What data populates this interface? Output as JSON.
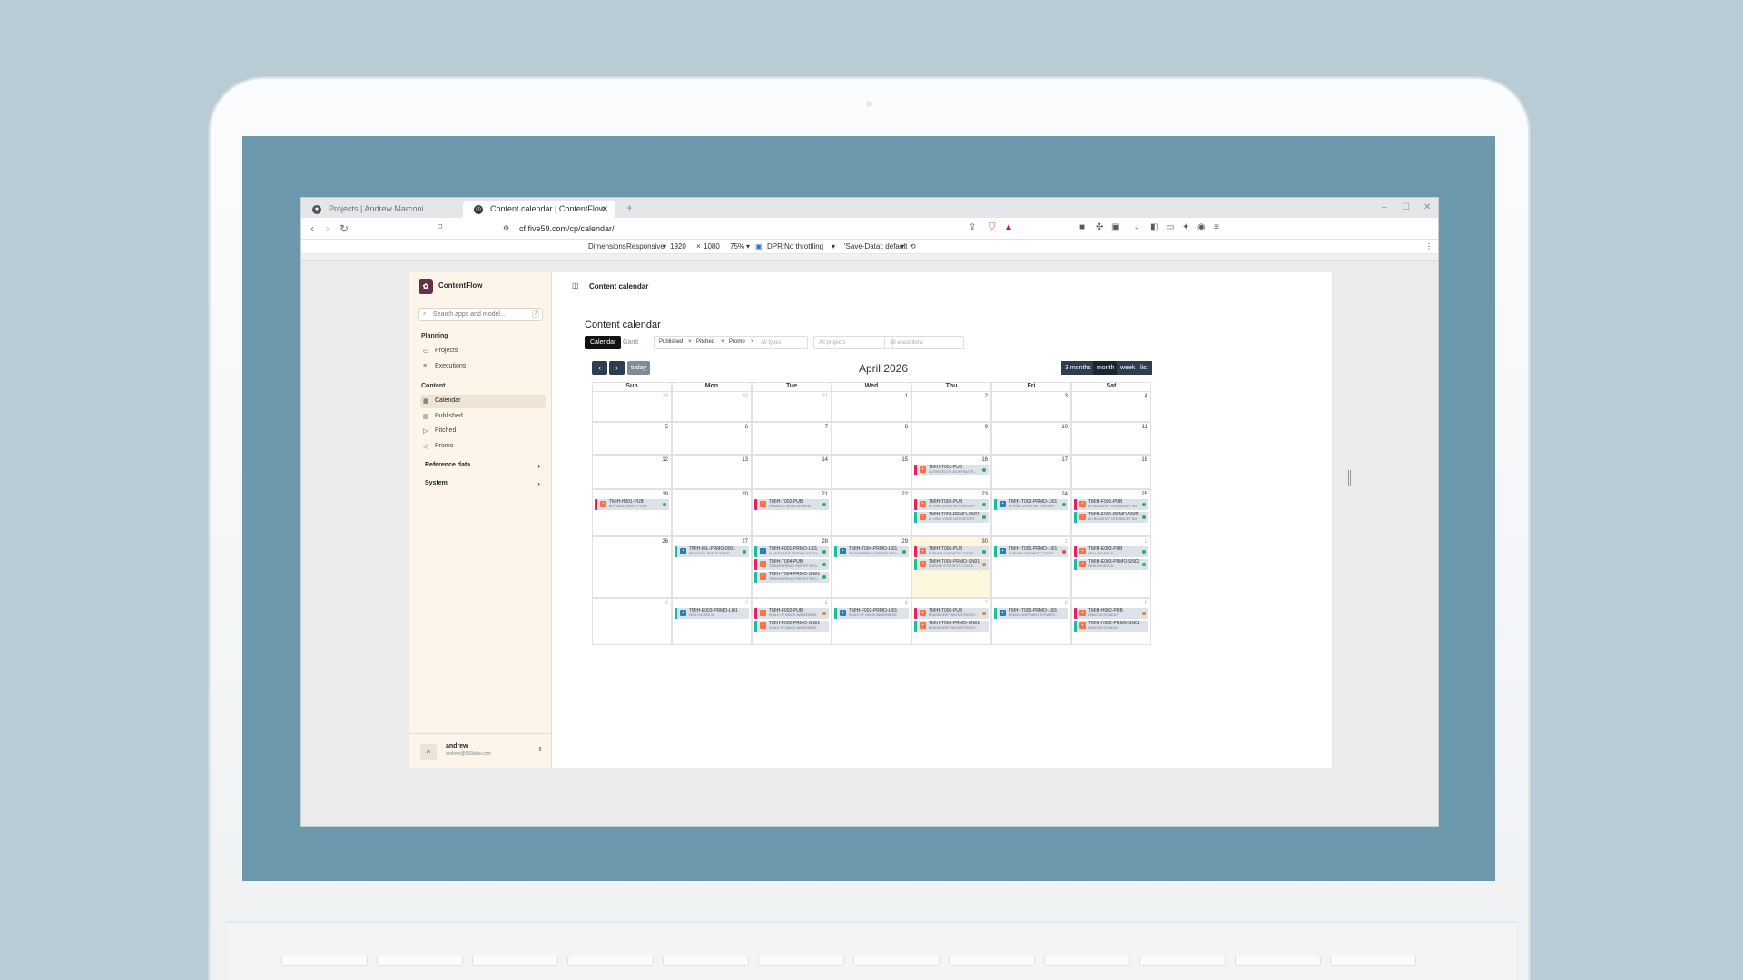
{
  "browser": {
    "tabs": [
      {
        "title": "Projects | Andrew Marconi",
        "active": false
      },
      {
        "title": "Content calendar | ContentFlow",
        "active": true
      }
    ],
    "url": "cf.five59.com/cp/calendar/",
    "devtools": {
      "dimensions_label": "Dimensions:",
      "device": "Responsive",
      "width": "1920",
      "height": "1080",
      "zoom": "75%",
      "dpr": "DPR:",
      "throttling": "No throttling",
      "save_data": "'Save-Data': default"
    }
  },
  "app": {
    "brand": "ContentFlow",
    "search_placeholder": "Search apps and model...",
    "search_shortcut": "/",
    "sections": {
      "planning": "Planning",
      "content": "Content"
    },
    "planning_items": [
      "Projects",
      "Executions"
    ],
    "content_items": [
      "Calendar",
      "Published",
      "Pitched",
      "Promo"
    ],
    "groups": [
      "Reference data",
      "System"
    ],
    "user": {
      "initial": "A",
      "name": "andrew",
      "email": "andrew@559labs.com"
    },
    "topbar_title": "Content calendar"
  },
  "page": {
    "title": "Content calendar",
    "views": [
      "Calendar",
      "Gantt"
    ],
    "type_chips": [
      "Published",
      "Pitched",
      "Promo"
    ],
    "types_placeholder": "All types",
    "projects_placeholder": "All projects",
    "executions_placeholder": "All executions",
    "today": "today",
    "month_title": "April 2026",
    "view_buttons": [
      "3 months",
      "month",
      "week",
      "list"
    ]
  },
  "calendar": {
    "weekdays": [
      "Sun",
      "Mon",
      "Tue",
      "Wed",
      "Thu",
      "Fri",
      "Sat"
    ],
    "weeks": [
      [
        {
          "d": "29",
          "dim": true
        },
        {
          "d": "30",
          "dim": true
        },
        {
          "d": "31",
          "dim": true
        },
        {
          "d": "1"
        },
        {
          "d": "2"
        },
        {
          "d": "3"
        },
        {
          "d": "4"
        }
      ],
      [
        {
          "d": "5"
        },
        {
          "d": "6"
        },
        {
          "d": "7"
        },
        {
          "d": "8"
        },
        {
          "d": "9"
        },
        {
          "d": "10"
        },
        {
          "d": "11"
        }
      ],
      [
        {
          "d": "12"
        },
        {
          "d": "13"
        },
        {
          "d": "14"
        },
        {
          "d": "15"
        },
        {
          "d": "16",
          "events": [
            {
              "t": "TMIH-T001-PUB",
              "s": "AUTHENTICITY AS INFRASTR...",
              "bar": "#e91e63",
              "icon": "#ff7043",
              "dot": "#27ae60"
            }
          ]
        },
        {
          "d": "17"
        },
        {
          "d": "18"
        }
      ],
      [
        {
          "d": "19",
          "events": [
            {
              "t": "TMIH-H001-PUB",
              "s": "AI FRAUD IDENTITY LINE",
              "bar": "#e91e63",
              "icon": "#ff7043",
              "dot": "#27ae60"
            }
          ]
        },
        {
          "d": "20"
        },
        {
          "d": "21",
          "events": [
            {
              "t": "TMIH-T002-PUB",
              "s": "DRAMATIC WORD AUTHEN...",
              "bar": "#e91e63",
              "icon": "#ff7043",
              "dot": "#27ae60"
            }
          ]
        },
        {
          "d": "22"
        },
        {
          "d": "23",
          "events": [
            {
              "t": "TMIH-T003-PUB",
              "s": "AI VIRAL VOICE NOT HISTORY",
              "bar": "#e91e63",
              "icon": "#ff7043",
              "dot": "#27ae60"
            },
            {
              "t": "TMIH-T003-PRMO-SN01",
              "s": "AI VIRAL VOICE NOT HISTORY",
              "bar": "#1abc9c",
              "icon": "#ff7043",
              "dot": "#27ae60"
            }
          ]
        },
        {
          "d": "24",
          "events": [
            {
              "t": "TMIH-T003-PRMO-LI01",
              "s": "AI VIRAL VOICE NOT HISTORY",
              "bar": "#1abc9c",
              "icon": "#2980b9",
              "dot": "#27ae60"
            }
          ]
        },
        {
          "d": "25",
          "events": [
            {
              "t": "TMIH-F001-PUB",
              "s": "AI HEADSHOT CREDIBILITY TAX",
              "bar": "#e91e63",
              "icon": "#ff7043",
              "dot": "#27ae60"
            },
            {
              "t": "TMIH-F001-PRMO-SN01",
              "s": "AI HEADSHOT CREDIBILITY TAX",
              "bar": "#1abc9c",
              "icon": "#ff7043",
              "dot": "#27ae60"
            }
          ]
        }
      ],
      [
        {
          "d": "26"
        },
        {
          "d": "27",
          "events": [
            {
              "t": "TMIH-IRL-PRMO-0001",
              "s": "PERSONAL REFLECTIONS",
              "bar": "#1abc9c",
              "icon": "#2980b9",
              "dot": "#27ae60"
            }
          ]
        },
        {
          "d": "28",
          "events": [
            {
              "t": "TMIH-F001-PRMO-LI01",
              "s": "AI HEADSHOT CREDIBILITY TAX",
              "bar": "#1abc9c",
              "icon": "#2980b9",
              "dot": "#27ae60"
            },
            {
              "t": "TMIH-T004-PUB",
              "s": "TRANSPARENCY REPORT BRO...",
              "bar": "#e91e63",
              "icon": "#ff7043",
              "dot": "#27ae60"
            },
            {
              "t": "TMIH-T004-PRMO-SN01",
              "s": "TRANSPARENCY REPORT BRO...",
              "bar": "#1abc9c",
              "icon": "#ff7043",
              "dot": "#27ae60"
            }
          ]
        },
        {
          "d": "29",
          "events": [
            {
              "t": "TMIH-T004-PRMO-LI01",
              "s": "TRANSPARENCY REPORT BRO...",
              "bar": "#1abc9c",
              "icon": "#2980b9",
              "dot": "#27ae60"
            }
          ]
        },
        {
          "d": "30",
          "hl": true,
          "events": [
            {
              "t": "TMIH-T005-PUB",
              "s": "SURVIVE SYNTHETIC CONTE...",
              "bar": "#e91e63",
              "icon": "#ff7043",
              "dot": "#27ae60"
            },
            {
              "t": "TMIH-T005-PRMO-SN01",
              "s": "SURVIVE SYNTHETIC CONTE...",
              "bar": "#1abc9c",
              "icon": "#ff7043",
              "dot": "#e67e22"
            }
          ]
        },
        {
          "d": "1",
          "dim": true,
          "events": [
            {
              "t": "TMIH-T005-PRMO-LI01",
              "s": "SURVIVE SYNTHETIC CONTE...",
              "bar": "#1abc9c",
              "icon": "#2980b9",
              "dot": "#e74c3c"
            }
          ]
        },
        {
          "d": "2",
          "dim": true,
          "events": [
            {
              "t": "TMIH-E003-PUB",
              "s": "HEALTHCARE AI",
              "bar": "#e91e63",
              "icon": "#ff7043",
              "dot": "#27ae60"
            },
            {
              "t": "TMIH-E003-PRMO-SN01",
              "s": "HEALTHCARE AI",
              "bar": "#1abc9c",
              "icon": "#ff7043",
              "dot": "#27ae60"
            }
          ]
        }
      ],
      [
        {
          "d": "3",
          "dim": true
        },
        {
          "d": "4",
          "dim": true,
          "events": [
            {
              "t": "TMIH-E003-PRMO-LI01",
              "s": "HEALTHCARE AI",
              "bar": "#1abc9c",
              "icon": "#2980b9",
              "dot": "#e5e5e5"
            }
          ]
        },
        {
          "d": "5",
          "dim": true,
          "events": [
            {
              "t": "TMIH-F002-PUB",
              "s": "SCALE OF IMAGE AWARENESS",
              "bar": "#e91e63",
              "icon": "#ff7043",
              "dot": "#e67e22"
            },
            {
              "t": "TMIH-F002-PRMO-SN01",
              "s": "SCALE OF IMAGE AWARENESS",
              "bar": "#1abc9c",
              "icon": "#ff7043",
              "dot": "#e5e5e5"
            }
          ]
        },
        {
          "d": "6",
          "dim": true,
          "events": [
            {
              "t": "TMIH-F002-PRMO-LI01",
              "s": "SCALE OF IMAGE AWARENESS",
              "bar": "#1abc9c",
              "icon": "#2980b9",
              "dot": "#e5e5e5"
            }
          ]
        },
        {
          "d": "7",
          "dim": true,
          "events": [
            {
              "t": "TMIH-T006-PUB",
              "s": "BRAND DEEPFAKES STRATEG...",
              "bar": "#e91e63",
              "icon": "#ff7043",
              "dot": "#e67e22"
            },
            {
              "t": "TMIH-T006-PRMO-SN01",
              "s": "BRAND DEEPFAKES STRATEG...",
              "bar": "#1abc9c",
              "icon": "#ff7043",
              "dot": "#e5e5e5"
            }
          ]
        },
        {
          "d": "8",
          "dim": true,
          "events": [
            {
              "t": "TMIH-T006-PRMO-LI01",
              "s": "BRAND DEEPFAKES STRATEG...",
              "bar": "#1abc9c",
              "icon": "#2980b9",
              "dot": "#e5e5e5"
            }
          ]
        },
        {
          "d": "9",
          "dim": true,
          "events": [
            {
              "t": "TMIH-H002-PUB",
              "s": "DRAGON STANDUP",
              "bar": "#e91e63",
              "icon": "#ff7043",
              "dot": "#e67e22"
            },
            {
              "t": "TMIH-H002-PRMO-SN01",
              "s": "DRAGON STANDUP",
              "bar": "#1abc9c",
              "icon": "#ff7043",
              "dot": "#e5e5e5"
            }
          ]
        }
      ]
    ]
  }
}
